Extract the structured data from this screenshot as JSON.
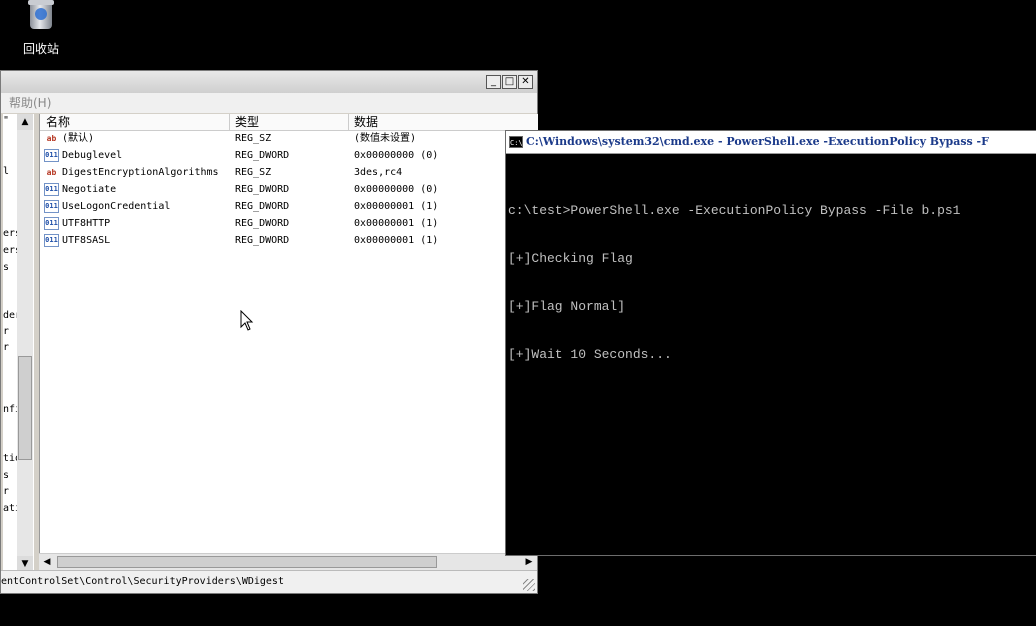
{
  "desktop": {
    "recycle_bin_label": "回收站"
  },
  "regedit": {
    "window_controls": {
      "minimize": "_",
      "maximize": "□",
      "close": "✕"
    },
    "menu": {
      "help": "帮助(H)"
    },
    "columns": {
      "name": "名称",
      "type": "类型",
      "data": "数据"
    },
    "tree_fragments": [
      "\"",
      "l",
      "ers",
      "ers",
      "s",
      "der",
      "r",
      "r",
      "nfi",
      "tion",
      "s",
      "r",
      "ati"
    ],
    "values": [
      {
        "icon": "string-value-icon",
        "name": "(默认)",
        "type": "REG_SZ",
        "data": "(数值未设置)"
      },
      {
        "icon": "binary-value-icon",
        "name": "Debuglevel",
        "type": "REG_DWORD",
        "data": "0x00000000 (0)"
      },
      {
        "icon": "string-value-icon",
        "name": "DigestEncryptionAlgorithms",
        "type": "REG_SZ",
        "data": "3des,rc4"
      },
      {
        "icon": "binary-value-icon",
        "name": "Negotiate",
        "type": "REG_DWORD",
        "data": "0x00000000 (0)"
      },
      {
        "icon": "binary-value-icon",
        "name": "UseLogonCredential",
        "type": "REG_DWORD",
        "data": "0x00000001 (1)"
      },
      {
        "icon": "binary-value-icon",
        "name": "UTF8HTTP",
        "type": "REG_DWORD",
        "data": "0x00000001 (1)"
      },
      {
        "icon": "binary-value-icon",
        "name": "UTF8SASL",
        "type": "REG_DWORD",
        "data": "0x00000001 (1)"
      }
    ],
    "status_path": "entControlSet\\Control\\SecurityProviders\\WDigest"
  },
  "cmd": {
    "title": "C:\\Windows\\system32\\cmd.exe - PowerShell.exe  -ExecutionPolicy Bypass -F",
    "icon_text": "C:\\",
    "lines": [
      "c:\\test>PowerShell.exe -ExecutionPolicy Bypass -File b.ps1",
      "[+]Checking Flag",
      "[+]Flag Normal]",
      "[+]Wait 10 Seconds..."
    ]
  }
}
